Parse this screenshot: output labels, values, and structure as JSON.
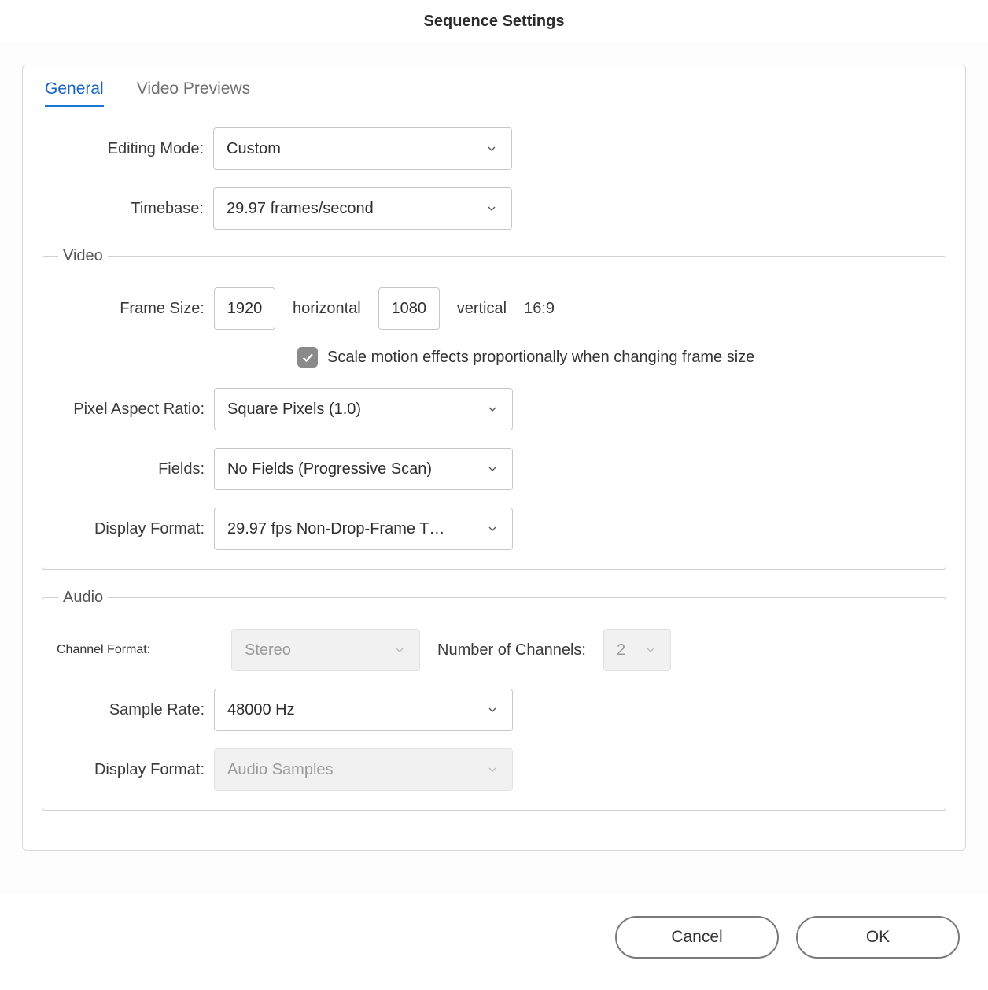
{
  "title": "Sequence Settings",
  "tabs": {
    "general": "General",
    "video_previews": "Video Previews"
  },
  "labels": {
    "editing_mode": "Editing Mode:",
    "timebase": "Timebase:",
    "frame_size": "Frame Size:",
    "horizontal": "horizontal",
    "vertical": "vertical",
    "aspect": "16:9",
    "scale_effects": "Scale motion effects proportionally when changing frame size",
    "pixel_aspect": "Pixel Aspect Ratio:",
    "fields": "Fields:",
    "display_format_video": "Display Format:",
    "channel_format": "Channel Format:",
    "num_channels": "Number of Channels:",
    "sample_rate": "Sample Rate:",
    "display_format_audio": "Display Format:"
  },
  "groups": {
    "video": "Video",
    "audio": "Audio"
  },
  "values": {
    "editing_mode": "Custom",
    "timebase": "29.97  frames/second",
    "frame_w": "1920",
    "frame_h": "1080",
    "pixel_aspect": "Square Pixels (1.0)",
    "fields": "No Fields (Progressive Scan)",
    "display_format_video": "29.97 fps Non-Drop-Frame T…",
    "channel_format": "Stereo",
    "num_channels": "2",
    "sample_rate": "48000 Hz",
    "display_format_audio": "Audio Samples"
  },
  "buttons": {
    "cancel": "Cancel",
    "ok": "OK"
  }
}
